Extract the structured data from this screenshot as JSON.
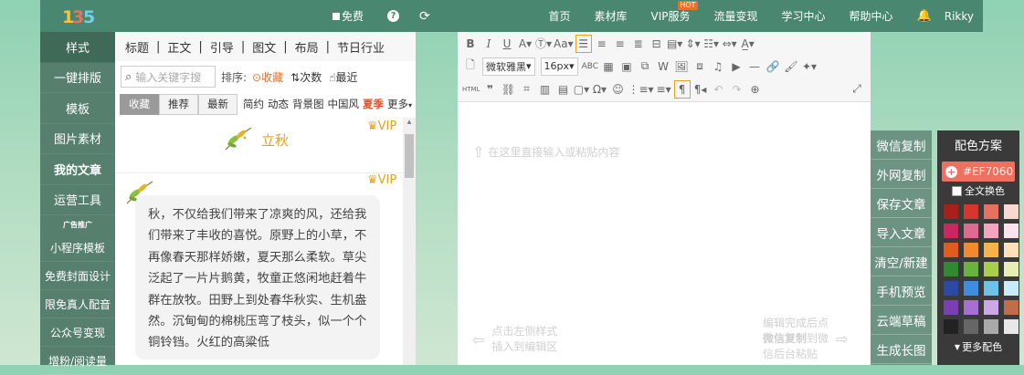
{
  "topbar": {
    "logo_text": "135",
    "mid": {
      "free": "免费",
      "help_icon": "?",
      "refresh_icon": "refresh"
    },
    "nav": [
      "首页",
      "素材库",
      "VIP服务",
      "流量变现",
      "学习中心",
      "帮助中心"
    ],
    "hot_badge": "HOT",
    "user": "Rikky"
  },
  "leftmenu": {
    "items": [
      "样式",
      "一键排版",
      "模板",
      "图片素材",
      "我的文章",
      "运营工具"
    ],
    "ad_label": "广告推广",
    "ad_items": [
      "小程序模板",
      "免费封面设计",
      "限免真人配音",
      "公众号变现",
      "增粉/阅读量"
    ]
  },
  "stylepanel": {
    "tabs": [
      "标题",
      "正文",
      "引导",
      "图文",
      "布局",
      "节日行业"
    ],
    "search_placeholder": "输入关键字搜",
    "sort_label": "排序:",
    "sort_options": [
      "收藏",
      "次数",
      "最近"
    ],
    "filter_buttons": [
      "收藏",
      "推荐",
      "最新"
    ],
    "filter_tags": [
      "简约",
      "动态",
      "背景图",
      "中国风",
      "夏季",
      "更多"
    ],
    "item1_title": "立秋",
    "vip_label": "VIP",
    "poem_text": "秋，不仅给我们带来了凉爽的风，还给我们带来了丰收的喜悦。原野上的小草，不再像春天那样娇嫩，夏天那么柔软。草尖泛起了一片片鹅黄，牧童正悠闲地赶着牛群在放牧。田野上到处春华秋实、生机盎然。沉甸甸的棉桃压弯了枝头，似一个个铜铃铛。火红的高粱低"
  },
  "editor": {
    "font_family": "微软雅黑",
    "font_size": "16px",
    "placeholder": "在这里直接输入或粘贴内容",
    "hint_left_1": "点击左侧样式",
    "hint_left_2": "插入到编辑区",
    "hint_right_1": "编辑完成后点",
    "hint_right_2a": "微信复制",
    "hint_right_2b": "到微",
    "hint_right_3": "信后台粘贴"
  },
  "actions": [
    "微信复制",
    "外网复制",
    "保存文章",
    "导入文章",
    "清空/新建",
    "手机预览",
    "云端草稿",
    "生成长图"
  ],
  "colorpanel": {
    "title": "配色方案",
    "current": "#EF7060",
    "all_label": "全文换色",
    "more_label": "更多配色",
    "swatches": [
      "#a8201a",
      "#d6362b",
      "#e8705f",
      "#f8d9cf",
      "#c8275f",
      "#e06a8f",
      "#f3a5bf",
      "#fce3ec",
      "#e05b1c",
      "#f08a2c",
      "#f6b34a",
      "#fde2b8",
      "#2f8a2f",
      "#68b33c",
      "#a9cf4a",
      "#e6f0b5",
      "#2d49a6",
      "#3d8de0",
      "#6ec2ea",
      "#c9ecf8",
      "#7a3fb3",
      "#a86fd2",
      "#cda8e6",
      "#c16c4a",
      "#222222",
      "#666666",
      "#a9a9a9",
      "#e8e8e8"
    ]
  }
}
